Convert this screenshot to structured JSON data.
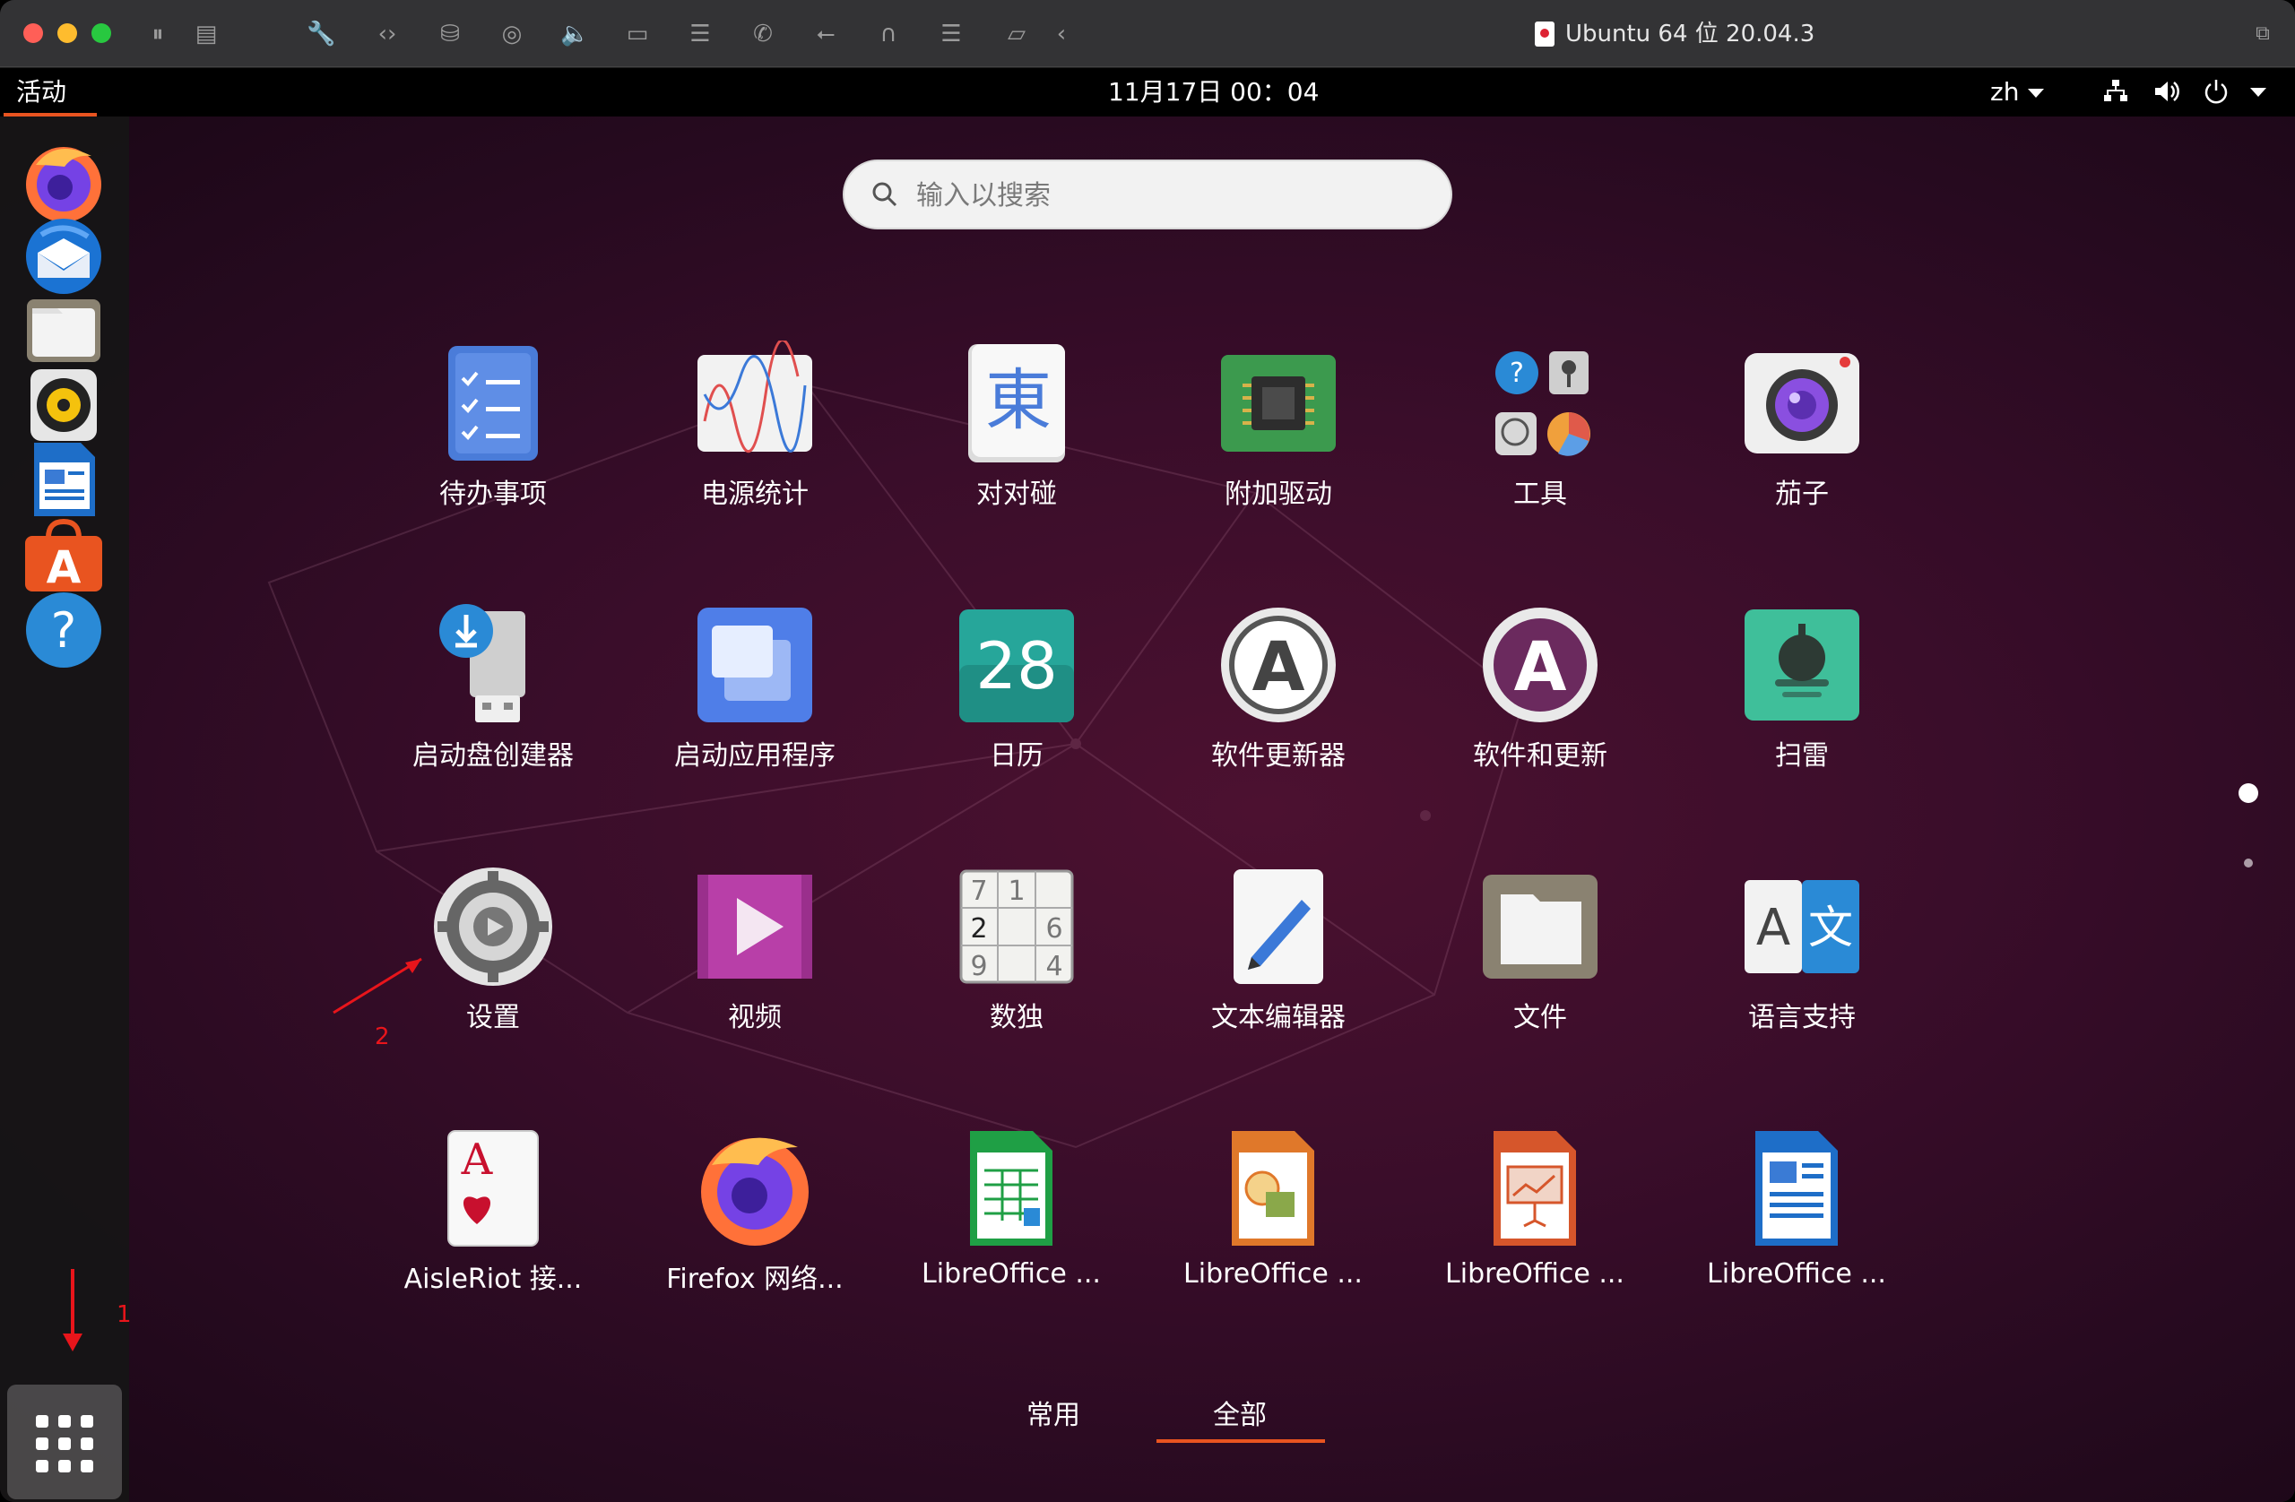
{
  "window": {
    "title": "Ubuntu 64 位 20.04.3",
    "traffic_lights": {
      "close": "#ff5f57",
      "minimize": "#febc2e",
      "maximize": "#28c840"
    },
    "toolbar_icons": [
      "pause-icon",
      "snapshot-icon",
      "wrench-icon",
      "code-arrows-icon",
      "harddisk-icon",
      "camera-icon",
      "audio-icon",
      "video-icon",
      "printer-icon",
      "phone-icon",
      "usb-icon",
      "headphones-icon",
      "network-icon",
      "folder-share-icon",
      "back-icon"
    ]
  },
  "topbar": {
    "activities": "活动",
    "clock": "11月17日  00：04",
    "language": "zh",
    "accent": "#e95420"
  },
  "dock": {
    "items": [
      {
        "name": "firefox"
      },
      {
        "name": "thunderbird"
      },
      {
        "name": "files"
      },
      {
        "name": "rhythmbox"
      },
      {
        "name": "libreoffice-writer"
      },
      {
        "name": "ubuntu-software"
      },
      {
        "name": "help"
      }
    ],
    "show_apps_label": "显示应用程序"
  },
  "search": {
    "placeholder": "输入以搜索"
  },
  "apps": [
    {
      "label": "待办事项"
    },
    {
      "label": "电源统计"
    },
    {
      "label": "对对碰"
    },
    {
      "label": "附加驱动"
    },
    {
      "label": "工具"
    },
    {
      "label": "茄子"
    },
    {
      "label": "启动盘创建器"
    },
    {
      "label": "启动应用程序"
    },
    {
      "label": "日历"
    },
    {
      "label": "软件更新器"
    },
    {
      "label": "软件和更新"
    },
    {
      "label": "扫雷"
    },
    {
      "label": "设置"
    },
    {
      "label": "视频"
    },
    {
      "label": "数独"
    },
    {
      "label": "文本编辑器"
    },
    {
      "label": "文件"
    },
    {
      "label": "语言支持"
    },
    {
      "label": "AisleRiot 接..."
    },
    {
      "label": "Firefox 网络..."
    },
    {
      "label": "LibreOffice ..."
    },
    {
      "label": "LibreOffice ..."
    },
    {
      "label": "LibreOffice ..."
    },
    {
      "label": "LibreOffice ..."
    }
  ],
  "icon_text": {
    "duiduipeng": "東",
    "calendar_day": "28",
    "sudoku": [
      "7",
      "1",
      "2",
      "6",
      "9",
      "4"
    ],
    "aisleriot": "A",
    "lang_a": "A",
    "lang_wen": "文"
  },
  "tabs": [
    {
      "label": "常用",
      "active": false
    },
    {
      "label": "全部",
      "active": true
    }
  ],
  "annotations": {
    "marker1": "1",
    "marker2": "2"
  }
}
